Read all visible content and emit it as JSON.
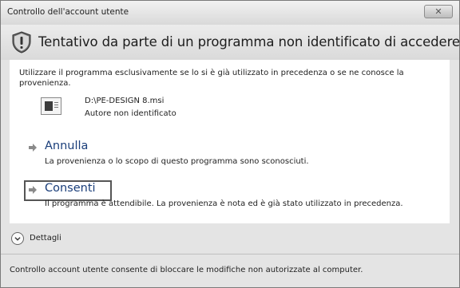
{
  "window": {
    "title": "Controllo dell'account utente",
    "close_symbol": "✕",
    "close_icon": "close-icon"
  },
  "heading": {
    "text": "Tentativo da parte di un programma non identificato di accedere al computer",
    "icon": "shield-warning-icon"
  },
  "content": {
    "intro": "Utilizzare il programma esclusivamente se lo si è già utilizzato in precedenza o se ne conosce la provenienza.",
    "file": {
      "name": "D:\\PE-DESIGN 8.msi",
      "author": "Autore non identificato",
      "icon": "msi-file-icon"
    },
    "options": [
      {
        "title": "Annulla",
        "description": "La provenienza o lo scopo di questo programma sono sconosciuti.",
        "icon": "arrow-right-icon"
      },
      {
        "title": "Consenti",
        "description": "Il programma è attendibile. La provenienza è nota ed è già stato utilizzato in precedenza.",
        "icon": "arrow-right-icon"
      }
    ]
  },
  "details": {
    "label": "Dettagli",
    "icon": "chevron-down-circle-icon"
  },
  "footer": {
    "text": "Controllo account utente consente di bloccare le modifiche non autorizzate al computer."
  },
  "colors": {
    "option_title": "#1a3e7a",
    "arrow": "#8a8a8a",
    "shield": "#6a6a6a"
  }
}
